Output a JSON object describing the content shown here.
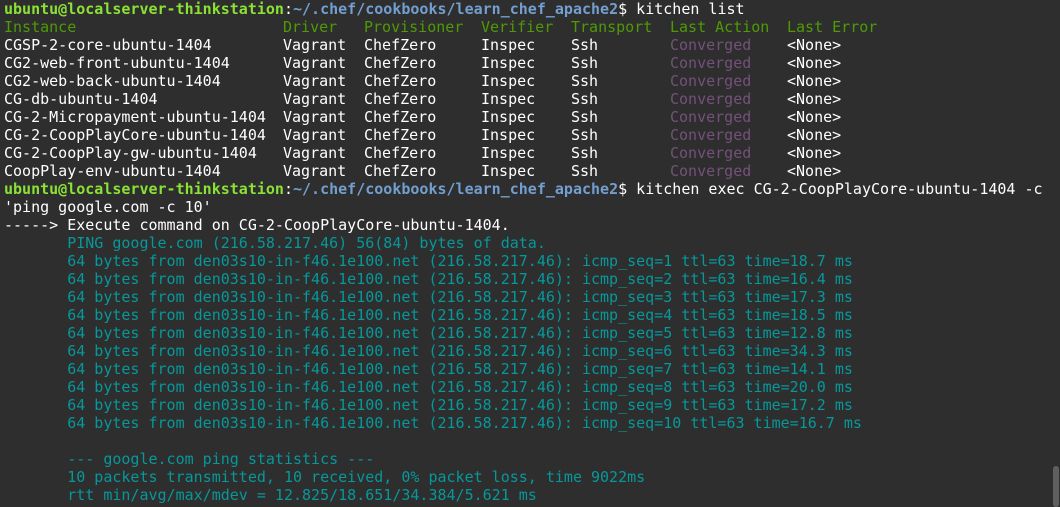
{
  "prompt": {
    "user_host": "ubuntu@localserver-thinkstation",
    "path": "~/.chef/cookbooks/learn_chef_apache2",
    "dollar": "$ "
  },
  "commands": {
    "list": "kitchen list",
    "exec": "kitchen exec CG-2-CoopPlayCore-ubuntu-1404 -c",
    "exec_cont": "'ping google.com -c 10'"
  },
  "table": {
    "headers": [
      "Instance",
      "Driver",
      "Provisioner",
      "Verifier",
      "Transport",
      "Last Action",
      "Last Error"
    ],
    "rows": [
      [
        "CGSP-2-core-ubuntu-1404",
        "Vagrant",
        "ChefZero",
        "Inspec",
        "Ssh",
        "Converged",
        "<None>"
      ],
      [
        "CG2-web-front-ubuntu-1404",
        "Vagrant",
        "ChefZero",
        "Inspec",
        "Ssh",
        "Converged",
        "<None>"
      ],
      [
        "CG2-web-back-ubuntu-1404",
        "Vagrant",
        "ChefZero",
        "Inspec",
        "Ssh",
        "Converged",
        "<None>"
      ],
      [
        "CG-db-ubuntu-1404",
        "Vagrant",
        "ChefZero",
        "Inspec",
        "Ssh",
        "Converged",
        "<None>"
      ],
      [
        "CG-2-Micropayment-ubuntu-1404",
        "Vagrant",
        "ChefZero",
        "Inspec",
        "Ssh",
        "Converged",
        "<None>"
      ],
      [
        "CG-2-CoopPlayCore-ubuntu-1404",
        "Vagrant",
        "ChefZero",
        "Inspec",
        "Ssh",
        "Converged",
        "<None>"
      ],
      [
        "CG-2-CoopPlay-gw-ubuntu-1404",
        "Vagrant",
        "ChefZero",
        "Inspec",
        "Ssh",
        "Converged",
        "<None>"
      ],
      [
        "CoopPlay-env-ubuntu-1404",
        "Vagrant",
        "ChefZero",
        "Inspec",
        "Ssh",
        "Converged",
        "<None>"
      ]
    ]
  },
  "output": {
    "execute": "-----> Execute command on CG-2-CoopPlayCore-ubuntu-1404.",
    "ping_header": "       PING google.com (216.58.217.46) 56(84) bytes of data.",
    "ping_lines": [
      "       64 bytes from den03s10-in-f46.1e100.net (216.58.217.46): icmp_seq=1 ttl=63 time=18.7 ms",
      "       64 bytes from den03s10-in-f46.1e100.net (216.58.217.46): icmp_seq=2 ttl=63 time=16.4 ms",
      "       64 bytes from den03s10-in-f46.1e100.net (216.58.217.46): icmp_seq=3 ttl=63 time=17.3 ms",
      "       64 bytes from den03s10-in-f46.1e100.net (216.58.217.46): icmp_seq=4 ttl=63 time=18.5 ms",
      "       64 bytes from den03s10-in-f46.1e100.net (216.58.217.46): icmp_seq=5 ttl=63 time=12.8 ms",
      "       64 bytes from den03s10-in-f46.1e100.net (216.58.217.46): icmp_seq=6 ttl=63 time=34.3 ms",
      "       64 bytes from den03s10-in-f46.1e100.net (216.58.217.46): icmp_seq=7 ttl=63 time=14.1 ms",
      "       64 bytes from den03s10-in-f46.1e100.net (216.58.217.46): icmp_seq=8 ttl=63 time=20.0 ms",
      "       64 bytes from den03s10-in-f46.1e100.net (216.58.217.46): icmp_seq=9 ttl=63 time=17.2 ms",
      "       64 bytes from den03s10-in-f46.1e100.net (216.58.217.46): icmp_seq=10 ttl=63 time=16.7 ms"
    ],
    "blank": "",
    "stats_header": "       --- google.com ping statistics ---",
    "stats_packets": "       10 packets transmitted, 10 received, 0% packet loss, time 9022ms",
    "stats_rtt": "       rtt min/avg/max/mdev = 12.825/18.651/34.384/5.621 ms"
  },
  "colors": {
    "background": "#2e2e2e",
    "prompt_user": "#8ae234",
    "prompt_path": "#729fcf",
    "table_header": "#4e9a06",
    "last_action": "#75507b",
    "ping_output": "#06989a"
  }
}
